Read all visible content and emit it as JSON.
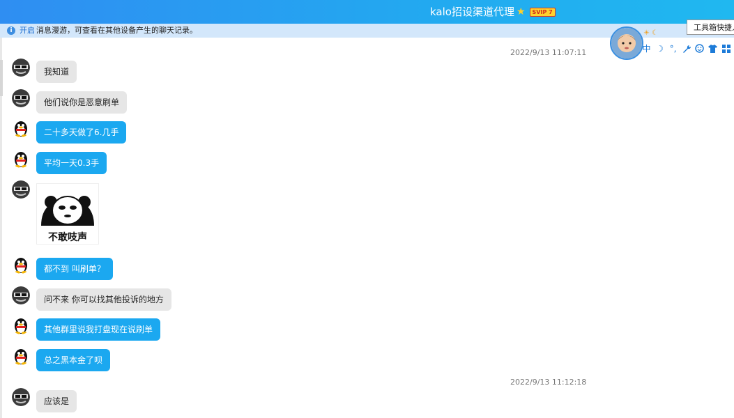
{
  "window": {
    "title": "kalo招设渠道代理",
    "badge": "SVIP 7",
    "star_icon": "star-icon"
  },
  "notice": {
    "link": "开启",
    "text": "消息漫游，可查看在其他设备产生的聊天记录。"
  },
  "toolbar": {
    "tooltip": "工具箱快捷入口",
    "input_method": "中",
    "icons": [
      "moon-icon",
      "dots-icon",
      "wrench-icon",
      "smiley-icon",
      "shirt-icon",
      "grid-icon"
    ]
  },
  "messages": [
    {
      "type": "timestamp",
      "text": "2022/9/13 11:07:11"
    },
    {
      "sender": "other",
      "text": "我知道"
    },
    {
      "sender": "other",
      "text": "他们说你是恶意刷单"
    },
    {
      "sender": "self",
      "text": "二十多天做了6.几手"
    },
    {
      "sender": "self",
      "text": "平均一天0.3手"
    },
    {
      "sender": "other",
      "type": "sticker",
      "text": "不敢吱声"
    },
    {
      "sender": "self",
      "text": "都不到 叫刷单？"
    },
    {
      "sender": "other",
      "text": "问不来 你可以找其他投诉的地方"
    },
    {
      "sender": "self",
      "text": "其他群里说我打盘现在说刷单"
    },
    {
      "sender": "self",
      "text": "总之黑本金了呗"
    },
    {
      "type": "timestamp",
      "text": "2022/9/13 11:12:18"
    },
    {
      "sender": "other",
      "text": "应该是"
    }
  ],
  "colors": {
    "titlebar": "#2f8ef2",
    "self_bubble": "#1ba8f0",
    "other_bubble": "#e6e6e6"
  }
}
